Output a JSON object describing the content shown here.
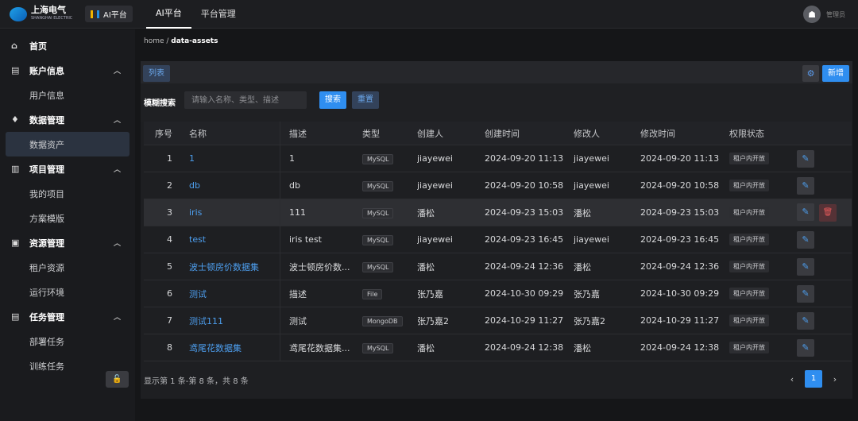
{
  "header": {
    "logo_text": "上海电气",
    "logo_sub": "SHANGHAI ELECTRIC",
    "platform_badge": "AI平台",
    "nav": [
      {
        "label": "AI平台",
        "active": true
      },
      {
        "label": "平台管理",
        "active": false
      }
    ],
    "user_name": "管理员"
  },
  "sidebar": {
    "items": [
      {
        "type": "group",
        "label": "首页",
        "icon": "home-icon",
        "glyph": "⌂",
        "chevron": false
      },
      {
        "type": "group",
        "label": "账户信息",
        "icon": "id-card-icon",
        "glyph": "▤",
        "chevron": true
      },
      {
        "type": "sub",
        "label": "用户信息"
      },
      {
        "type": "group",
        "label": "数据管理",
        "icon": "bulb-icon",
        "glyph": "♦",
        "chevron": true
      },
      {
        "type": "sub",
        "label": "数据资产",
        "selected": true
      },
      {
        "type": "group",
        "label": "项目管理",
        "icon": "bar-chart-icon",
        "glyph": "▥",
        "chevron": true
      },
      {
        "type": "sub",
        "label": "我的项目"
      },
      {
        "type": "sub",
        "label": "方案模版"
      },
      {
        "type": "group",
        "label": "资源管理",
        "icon": "resource-icon",
        "glyph": "▣",
        "chevron": true
      },
      {
        "type": "sub",
        "label": "租户资源"
      },
      {
        "type": "sub",
        "label": "运行环境"
      },
      {
        "type": "group",
        "label": "任务管理",
        "icon": "task-icon",
        "glyph": "▤",
        "chevron": true
      },
      {
        "type": "sub",
        "label": "部署任务"
      },
      {
        "type": "sub",
        "label": "训练任务"
      }
    ],
    "lock_icon": "unlock-icon"
  },
  "breadcrumb": {
    "root": "home",
    "current": "data-assets"
  },
  "panel": {
    "tab_label": "列表",
    "add_label": "新增",
    "search_label": "模糊搜索",
    "search_placeholder": "请输入名称、类型、描述",
    "search_value": "",
    "search_button": "搜索",
    "reset_button": "重置"
  },
  "table": {
    "columns": [
      "序号",
      "名称",
      "描述",
      "类型",
      "创建人",
      "创建时间",
      "修改人",
      "修改时间",
      "权限状态"
    ],
    "rows": [
      {
        "index": "1",
        "name": "1",
        "desc": "1",
        "type": "MySQL",
        "creator": "jiayewei",
        "created": "2024-09-20 11:13",
        "modifier": "jiayewei",
        "modified": "2024-09-20 11:13",
        "perm": "租户内开放",
        "deletable": false,
        "highlight": false
      },
      {
        "index": "2",
        "name": "db",
        "desc": "db",
        "type": "MySQL",
        "creator": "jiayewei",
        "created": "2024-09-20 10:58",
        "modifier": "jiayewei",
        "modified": "2024-09-20 10:58",
        "perm": "租户内开放",
        "deletable": false,
        "highlight": false
      },
      {
        "index": "3",
        "name": "iris",
        "desc": "111",
        "type": "MySQL",
        "creator": "潘松",
        "created": "2024-09-23 15:03",
        "modifier": "潘松",
        "modified": "2024-09-23 15:03",
        "perm": "租户内开放",
        "deletable": true,
        "highlight": true
      },
      {
        "index": "4",
        "name": "test",
        "desc": "iris test",
        "type": "MySQL",
        "creator": "jiayewei",
        "created": "2024-09-23 16:45",
        "modifier": "jiayewei",
        "modified": "2024-09-23 16:45",
        "perm": "租户内开放",
        "deletable": false,
        "highlight": false
      },
      {
        "index": "5",
        "name": "波士顿房价数据集",
        "desc": "波士顿房价数...",
        "type": "MySQL",
        "creator": "潘松",
        "created": "2024-09-24 12:36",
        "modifier": "潘松",
        "modified": "2024-09-24 12:36",
        "perm": "租户内开放",
        "deletable": false,
        "highlight": false
      },
      {
        "index": "6",
        "name": "测试",
        "desc": "描述",
        "type": "File",
        "creator": "张乃嘉",
        "created": "2024-10-30 09:29",
        "modifier": "张乃嘉",
        "modified": "2024-10-30 09:29",
        "perm": "租户内开放",
        "deletable": false,
        "highlight": false
      },
      {
        "index": "7",
        "name": "测试111",
        "desc": "测试",
        "type": "MongoDB",
        "creator": "张乃嘉2",
        "created": "2024-10-29 11:27",
        "modifier": "张乃嘉2",
        "modified": "2024-10-29 11:27",
        "perm": "租户内开放",
        "deletable": false,
        "highlight": false
      },
      {
        "index": "8",
        "name": "鸢尾花数据集",
        "desc": "鸢尾花数据集...",
        "type": "MySQL",
        "creator": "潘松",
        "created": "2024-09-24 12:38",
        "modifier": "潘松",
        "modified": "2024-09-24 12:38",
        "perm": "租户内开放",
        "deletable": false,
        "highlight": false
      }
    ],
    "footer": "显示第 1 条-第 8 条，共 8 条",
    "page": "1"
  },
  "colors": {
    "accent": "#2f8ef0",
    "link": "#4d9eee",
    "danger": "#e45a5a",
    "bg": "#151618"
  }
}
